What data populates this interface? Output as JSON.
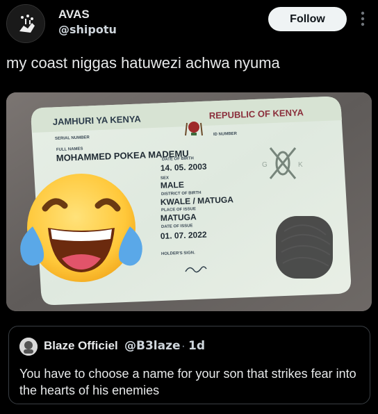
{
  "post": {
    "author_name": "AVAS",
    "author_handle": "@shipotu",
    "follow_label": "Follow",
    "more_icon": "more-vertical-icon",
    "text": "my coast niggas hatuwezi achwa nyuma"
  },
  "id_card": {
    "header_left": "JAMHURI YA KENYA",
    "header_right": "REPUBLIC OF KENYA",
    "serial_label": "SERIAL NUMBER",
    "id_number_label": "ID NUMBER",
    "full_names_label": "FULL NAMES",
    "full_names": "MOHAMMED POKEA MADEMU",
    "dob_label": "DATE OF BIRTH",
    "dob": "14. 05. 2003",
    "sex_label": "SEX",
    "sex": "MALE",
    "district_label": "DISTRICT OF BIRTH",
    "district": "KWALE / MATUGA",
    "place_label": "PLACE OF ISSUE",
    "place": "MATUGA",
    "issue_label": "DATE OF ISSUE",
    "issue_date": "01. 07. 2022",
    "sign_label": "HOLDER'S SIGN."
  },
  "emoji": "laughing-crying-emoji",
  "quote": {
    "author_name": "Blaze Officiel",
    "author_handle": "@B3laze",
    "separator": "·",
    "time": "1d",
    "text": "You have to choose a name for your son that strikes fear into the hearts of his enemies"
  }
}
